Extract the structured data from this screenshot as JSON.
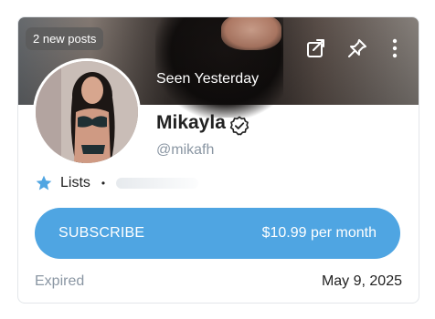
{
  "card": {
    "new_posts_badge": "2 new posts",
    "last_seen": "Seen Yesterday",
    "icons": {
      "share": "share-icon",
      "pin": "pin-icon",
      "more": "more-vertical-icon",
      "verified": "verified-badge-icon",
      "lists": "star-icon"
    },
    "profile": {
      "name": "Mikayla",
      "handle": "@mikafh"
    },
    "lists": {
      "label": "Lists",
      "separator": "•"
    },
    "subscribe": {
      "label": "SUBSCRIBE",
      "price": "$10.99 per month"
    },
    "status": {
      "label": "Expired",
      "date": "May 9, 2025"
    },
    "colors": {
      "accent": "#4fa5e2",
      "muted_text": "#8a96a3"
    }
  }
}
